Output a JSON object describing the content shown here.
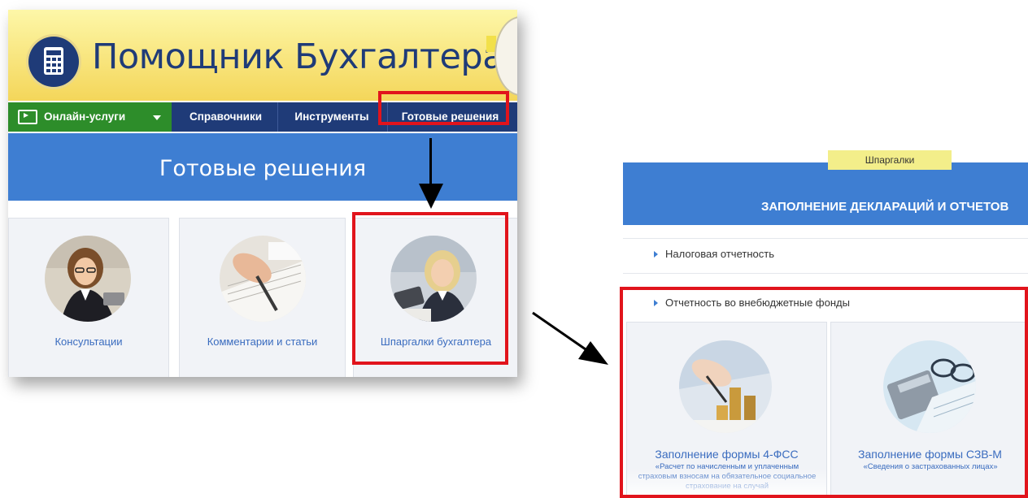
{
  "site": {
    "title": "Помощник Бухгалтера"
  },
  "nav": {
    "online_services": "Онлайн-услуги",
    "references": "Справочники",
    "tools": "Инструменты",
    "ready_solutions": "Готовые решения"
  },
  "section": {
    "title": "Готовые решения"
  },
  "cards": [
    {
      "label": "Консультации",
      "icon": "consultant-woman-photo"
    },
    {
      "label": "Комментарии и статьи",
      "icon": "writing-hand-photo"
    },
    {
      "label": "Шпаргалки бухгалтера",
      "icon": "accountant-woman-photo"
    }
  ],
  "right_panel": {
    "tag": "Шпаргалки",
    "banner_title": "ЗАПОЛНЕНИЕ ДЕКЛАРАЦИЙ И ОТЧЕТОВ",
    "items": [
      "Налоговая отчетность",
      "Отчетность во внебюджетные фонды"
    ],
    "cards": [
      {
        "title": "Заполнение формы 4-ФСС",
        "subtitle": "«Расчет по начисленным и уплаченным страховым взносам на обязательное социальное страхование на случай",
        "icon": "coins-and-pen-photo"
      },
      {
        "title": "Заполнение формы СЗВ-М",
        "subtitle": "«Сведения о застрахованных лицах»",
        "icon": "calculator-and-glasses-photo"
      }
    ]
  },
  "colors": {
    "nav_bg": "#1f3b78",
    "nav_online_bg": "#2d8d2a",
    "banner_blue": "#3e7ed2",
    "highlight_red": "#e1141c",
    "header_yellow": "#f4d65a",
    "link_blue": "#3a6cbf"
  }
}
